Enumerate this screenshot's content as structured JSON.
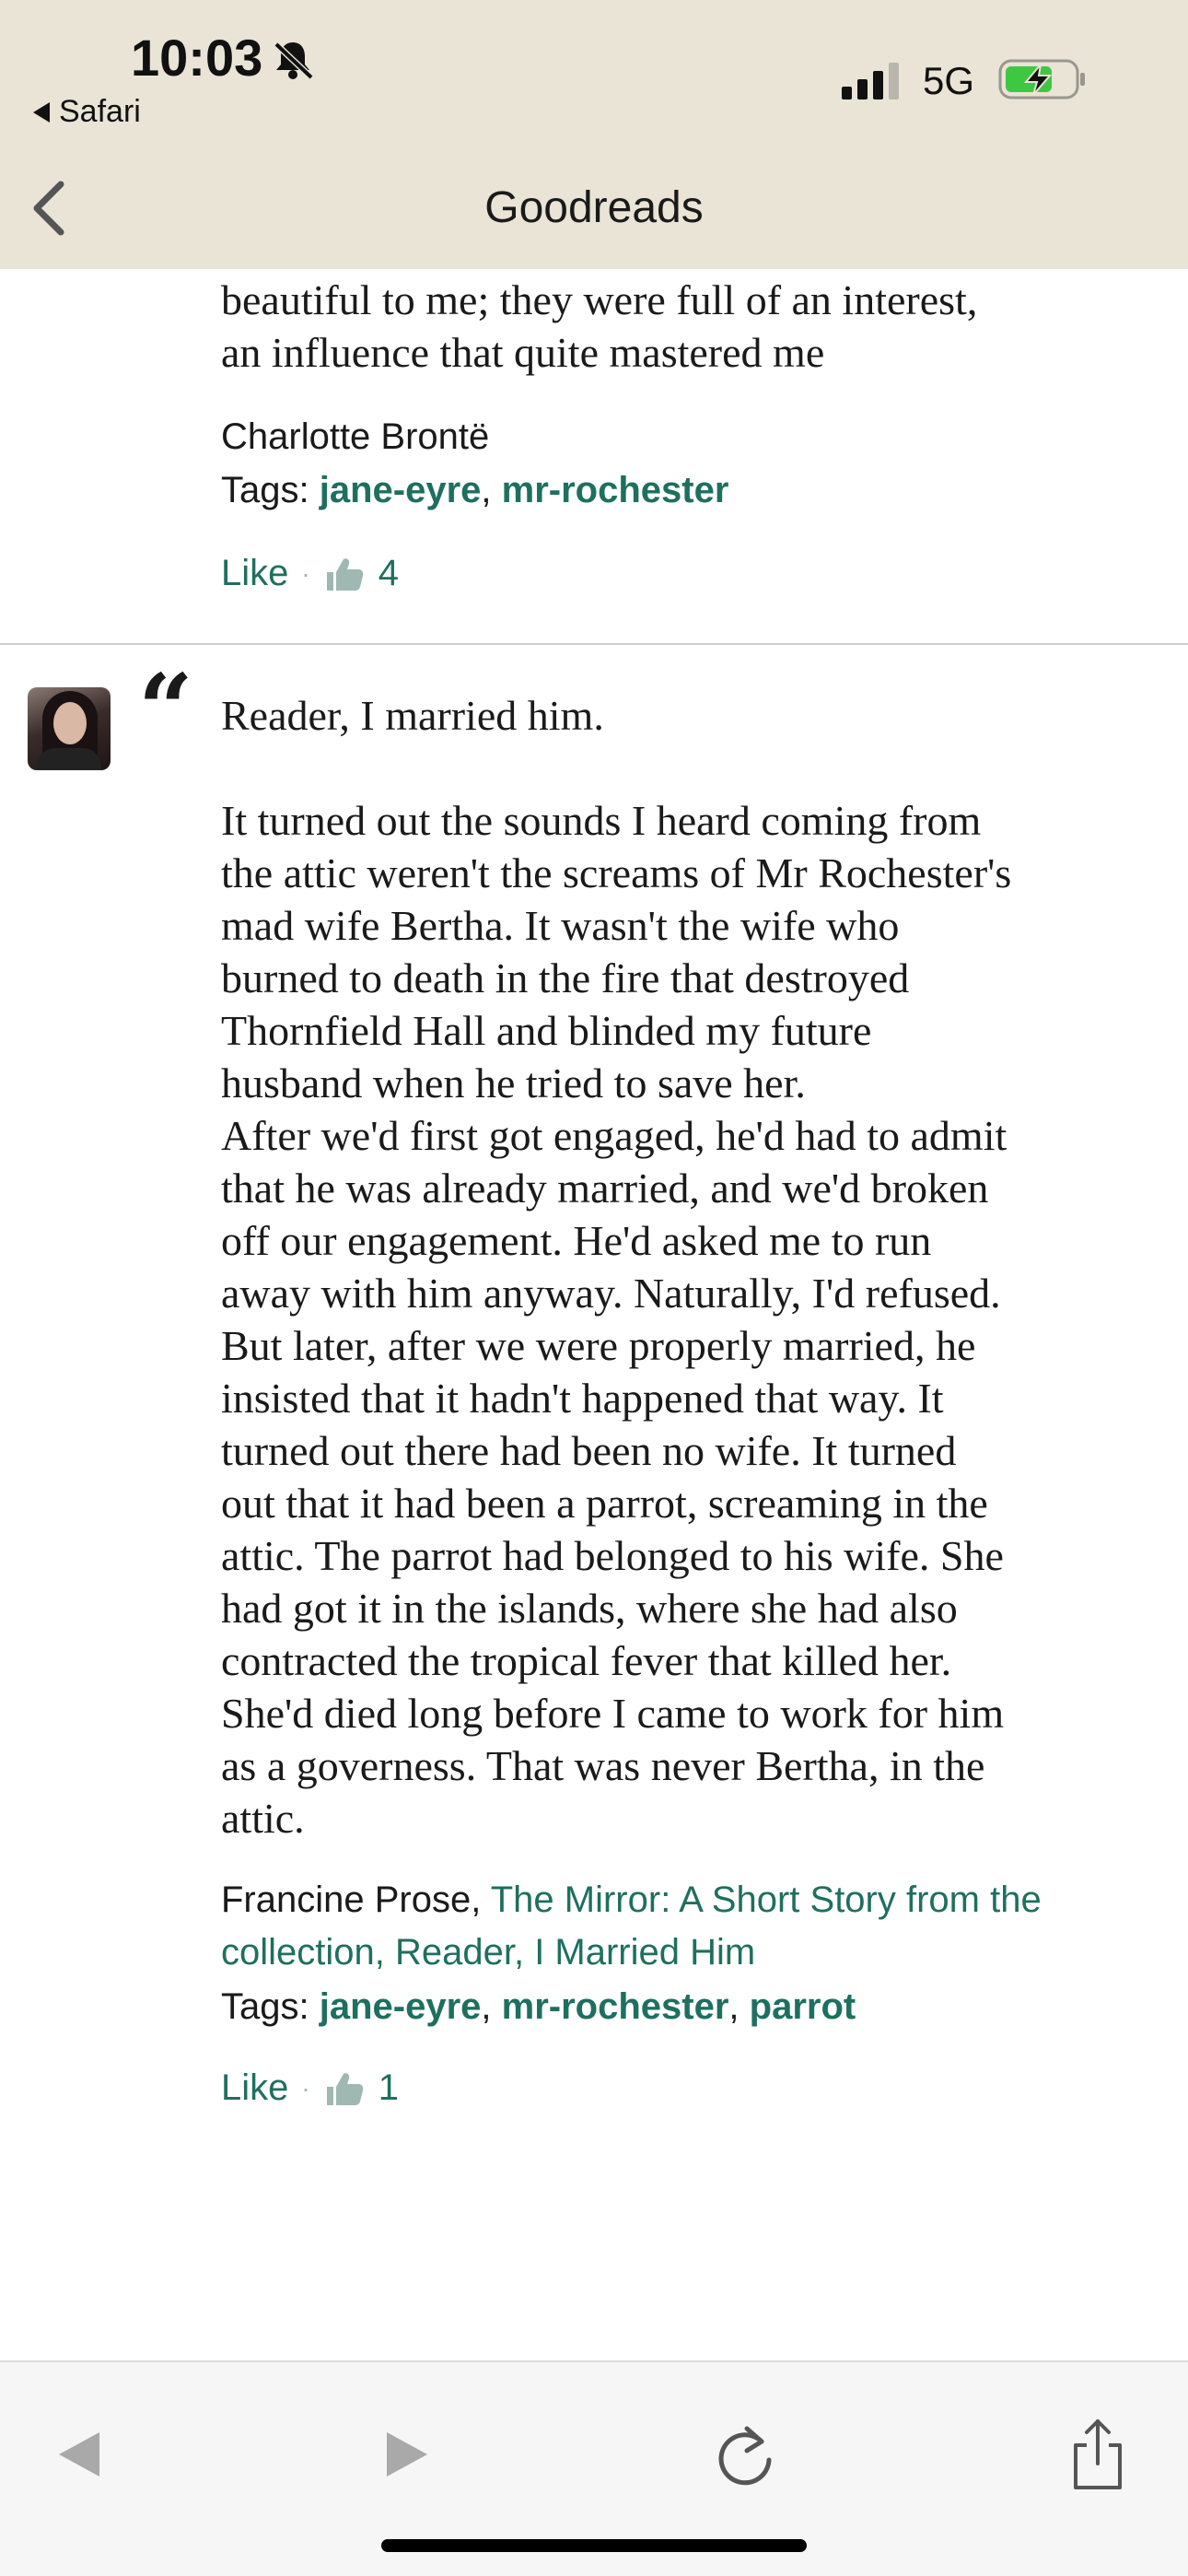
{
  "status_bar": {
    "time": "10:03",
    "back_app": "Safari",
    "network": "5G",
    "icons": [
      "bell-slash-icon",
      "signal-bars-icon",
      "battery-charging-icon"
    ]
  },
  "nav": {
    "title": "Goodreads",
    "back_icon": "chevron-left-icon"
  },
  "quotes": [
    {
      "text_visible": "beautiful to me; they were full of an interest,\nan influence that quite mastered me",
      "author": "Charlotte Brontë",
      "tags_label": "Tags:",
      "tags": [
        "jane-eyre",
        "mr-rochester"
      ],
      "like_label": "Like",
      "like_count": "4"
    },
    {
      "text": "Reader, I married him.\n\nIt turned out the sounds I heard coming from\nthe attic weren't the screams of Mr Rochester's\nmad wife Bertha. It wasn't the wife who\nburned to death in the fire that destroyed\nThornfield Hall and blinded my future\nhusband when he tried to save her.\nAfter we'd first got engaged, he'd had to admit\nthat he was already married, and we'd broken\noff our engagement. He'd asked me to run\naway with him anyway. Naturally, I'd refused.\nBut later, after we were properly married, he\ninsisted that it hadn't happened that way. It\nturned out there had been no wife. It turned\nout that it had been a parrot, screaming in the\nattic. The parrot had belonged to his wife. She\nhad got it in the islands, where she had also\ncontracted the tropical fever that killed her.\nShe'd died long before I came to work for him\nas a governess. That was never Bertha, in the\nattic.",
      "author": "Francine Prose,",
      "source": "The Mirror: A Short Story from the collection, Reader, I Married Him",
      "tags_label": "Tags:",
      "tags": [
        "jane-eyre",
        "mr-rochester",
        "parrot"
      ],
      "like_label": "Like",
      "like_count": "1"
    }
  ],
  "colors": {
    "header_bg": "#e9e4d6",
    "accent": "#1f6f5f",
    "text": "#1a1a1a"
  },
  "toolbar": {
    "icons": [
      "back-arrow-icon",
      "forward-arrow-icon",
      "reload-icon",
      "share-icon"
    ]
  }
}
